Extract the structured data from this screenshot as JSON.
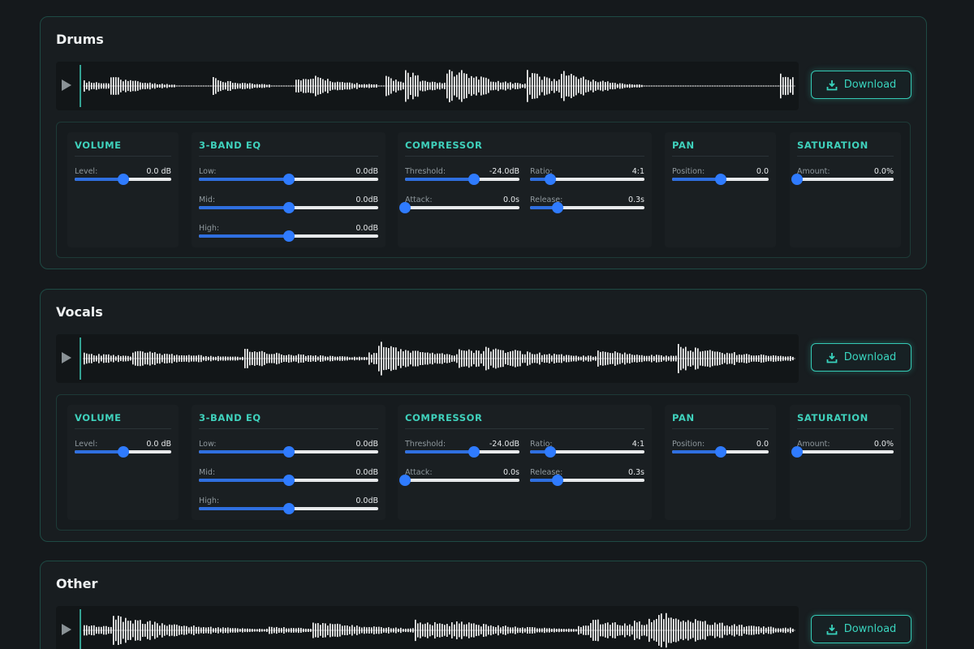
{
  "tracks": [
    {
      "name": "Drums",
      "download_label": "Download",
      "waveform_seed": 11,
      "effects": {
        "volume": {
          "title": "VOLUME",
          "level_label": "Level:",
          "level_value": "0.0 dB",
          "level_pos": 0.5
        },
        "eq": {
          "title": "3-BAND EQ",
          "low_label": "Low:",
          "low_value": "0.0dB",
          "low_pos": 0.5,
          "mid_label": "Mid:",
          "mid_value": "0.0dB",
          "mid_pos": 0.5,
          "high_label": "High:",
          "high_value": "0.0dB",
          "high_pos": 0.5
        },
        "compressor": {
          "title": "COMPRESSOR",
          "threshold_label": "Threshold:",
          "threshold_value": "-24.0dB",
          "threshold_pos": 0.6,
          "ratio_label": "Ratio:",
          "ratio_value": "4:1",
          "ratio_pos": 0.18,
          "attack_label": "Attack:",
          "attack_value": "0.0s",
          "attack_pos": 0.0,
          "release_label": "Release:",
          "release_value": "0.3s",
          "release_pos": 0.24
        },
        "pan": {
          "title": "PAN",
          "position_label": "Position:",
          "position_value": "0.0",
          "position_pos": 0.5
        },
        "saturation": {
          "title": "SATURATION",
          "amount_label": "Amount:",
          "amount_value": "0.0%",
          "amount_pos": 0.0
        }
      }
    },
    {
      "name": "Vocals",
      "download_label": "Download",
      "waveform_seed": 23,
      "effects": {
        "volume": {
          "title": "VOLUME",
          "level_label": "Level:",
          "level_value": "0.0 dB",
          "level_pos": 0.5
        },
        "eq": {
          "title": "3-BAND EQ",
          "low_label": "Low:",
          "low_value": "0.0dB",
          "low_pos": 0.5,
          "mid_label": "Mid:",
          "mid_value": "0.0dB",
          "mid_pos": 0.5,
          "high_label": "High:",
          "high_value": "0.0dB",
          "high_pos": 0.5
        },
        "compressor": {
          "title": "COMPRESSOR",
          "threshold_label": "Threshold:",
          "threshold_value": "-24.0dB",
          "threshold_pos": 0.6,
          "ratio_label": "Ratio:",
          "ratio_value": "4:1",
          "ratio_pos": 0.18,
          "attack_label": "Attack:",
          "attack_value": "0.0s",
          "attack_pos": 0.0,
          "release_label": "Release:",
          "release_value": "0.3s",
          "release_pos": 0.24
        },
        "pan": {
          "title": "PAN",
          "position_label": "Position:",
          "position_value": "0.0",
          "position_pos": 0.5
        },
        "saturation": {
          "title": "SATURATION",
          "amount_label": "Amount:",
          "amount_value": "0.0%",
          "amount_pos": 0.0
        }
      }
    },
    {
      "name": "Other",
      "download_label": "Download",
      "waveform_seed": 37
    }
  ],
  "icons": {
    "play": "play-icon",
    "download": "download-icon"
  },
  "colors": {
    "accent": "#3fd1bc",
    "slider_fill": "#2f6fe0",
    "slider_thumb": "#2f7bff",
    "waveform": "#ffffff",
    "background": "#15191c"
  }
}
